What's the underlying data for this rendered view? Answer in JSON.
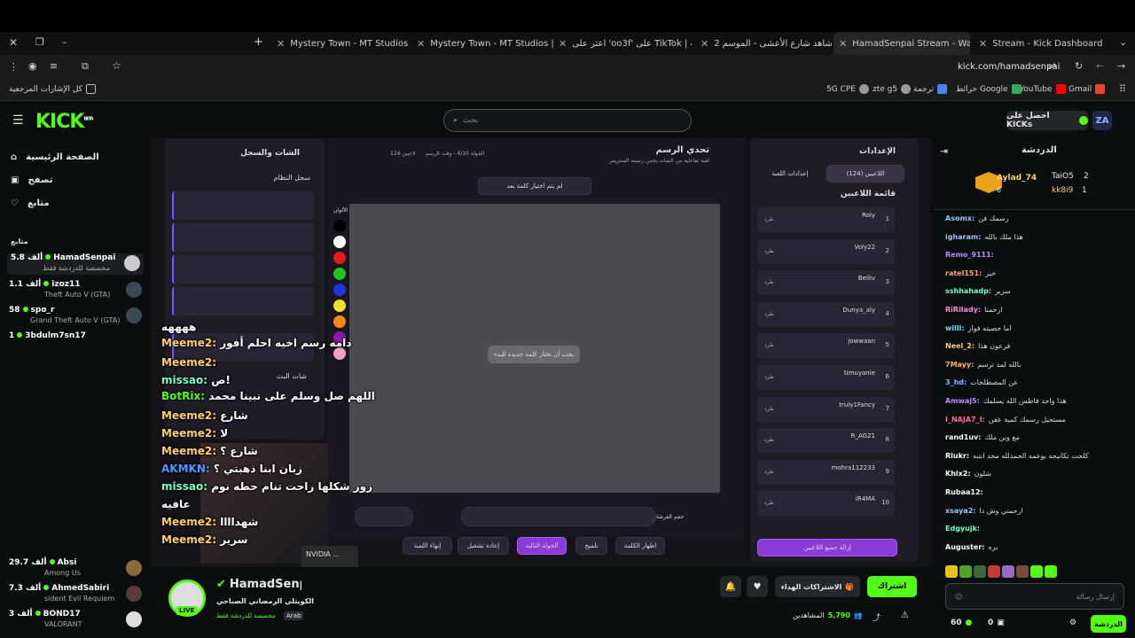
{
  "browser": {
    "tabs": [
      {
        "label": "Mystery Town - MT Studios | M"
      },
      {
        "label": "Mystery Town - MT Studios | M"
      },
      {
        "label": "اعثر على 'oo3f' على TikTok | بحث"
      },
      {
        "label": "شاهد شارع الأعشى - الموسم 2 /"
      },
      {
        "label": "HamadSenpai Stream - Watch"
      },
      {
        "label": "Stream - Kick Dashboard"
      }
    ],
    "url": "kick.com/hamadsenpai",
    "bookmarks": [
      {
        "label": "Gmail"
      },
      {
        "label": "YouTube"
      },
      {
        "label": "خرائط Google"
      },
      {
        "label": "ترجمة"
      },
      {
        "label": "zte g5"
      },
      {
        "label": "5G CPE"
      }
    ],
    "all_bookmarks": "كل الإشارات المرجعية"
  },
  "header": {
    "logo": "KICK",
    "logo_badge": "BETA",
    "search_placeholder": "بحث",
    "get_kicks": "احصل على KICKs",
    "avatar": "ZA"
  },
  "sidebar": {
    "nav": [
      {
        "label": "الصفحة الرئيسية",
        "icon": "home-icon"
      },
      {
        "label": "تصفح",
        "icon": "browse-icon"
      },
      {
        "label": "متابع",
        "icon": "heart-icon"
      }
    ],
    "following_title": "متابع",
    "channels": [
      {
        "name": "HamadSenpai",
        "viewers": "5.8 ألف",
        "game": "مخصصة للدردشة فقط"
      },
      {
        "name": "izoz11",
        "viewers": "1.1 ألف",
        "game": "Theft Auto V (GTA)"
      },
      {
        "name": "spo_r",
        "viewers": "58",
        "game": "Grand Theft Auto V (GTA)"
      },
      {
        "name": "3bdulm7sn17",
        "viewers": "1",
        "game": ""
      },
      {
        "name": "Absi",
        "viewers": "29.7 ألف",
        "game": "Among Us"
      },
      {
        "name": "AhmedSabiri",
        "viewers": "7.3 ألف",
        "game": "sident Evil Requiem"
      },
      {
        "name": "BOND17",
        "viewers": "3 ألف",
        "game": "VALORANT"
      }
    ]
  },
  "stream_overlay": {
    "messages": [
      {
        "user": "",
        "text": "ههههه"
      },
      {
        "user": "Meeme2:",
        "text": "دامه رسم اخيه احلم أفور"
      },
      {
        "user": "Meeme2:",
        "text": ""
      },
      {
        "user": "missao:",
        "text": "ص!"
      },
      {
        "user": "BotRix:",
        "text": "اللهم صل وسلم على نبينا محمد"
      },
      {
        "user": "Meeme2:",
        "text": "شارع"
      },
      {
        "user": "Meeme2:",
        "text": "لا"
      },
      {
        "user": "Meeme2:",
        "text": "شارع ؟"
      },
      {
        "user": "AKMKN:",
        "text": "زبان ابنا ذهبتي ؟"
      },
      {
        "user": "missao:",
        "text": "زور شكلها راحت تنام حطه نوم"
      },
      {
        "user": "",
        "text": "عافيه"
      },
      {
        "user": "Meeme2:",
        "text": "شهداااا"
      },
      {
        "user": "Meeme2:",
        "text": "سرير"
      }
    ],
    "game": {
      "title": "تحدي الرسم",
      "subtitle": "لعبة تفاعلية من الشات يخمن رسمة الستريمر",
      "round_info": "الجولة 4/10 - وقت الرسم",
      "players_count": "124 لاعبين",
      "no_word": "لم يتم اختيار كلمة بعد",
      "select_prompt": "يجب أن تختار كلمة جديدة للبدء",
      "settings_title": "الإعدادات",
      "tab_players": "اللاعبين (124)",
      "tab_game_settings": "إعدادات اللعبة",
      "players_list_title": "قائمة اللاعبين",
      "chat_log_title": "الشات والسجل",
      "system_log": "سجل النظام",
      "live_chat": "شات البث",
      "colors_label": "الألوان",
      "brush_size": "حجم الفرشاة",
      "players": [
        {
          "rank": "1",
          "name": "Roly"
        },
        {
          "rank": "2",
          "name": "Voly22"
        },
        {
          "rank": "3",
          "name": "Beiliv"
        },
        {
          "rank": "4",
          "name": "Dunya_aly"
        },
        {
          "rank": "5",
          "name": "jowwaan"
        },
        {
          "rank": "6",
          "name": "timuyanie"
        },
        {
          "rank": "7",
          "name": "truly1Fancy"
        },
        {
          "rank": "8",
          "name": "R_AG21"
        },
        {
          "rank": "9",
          "name": "mohra112233"
        },
        {
          "rank": "10",
          "name": "iR4MA"
        }
      ],
      "kick_label": "طرد",
      "remove_all": "إزالة جميع اللاعبين",
      "buttons": [
        "إنهاء اللعبة",
        "إعادة تشغيل",
        "الجولة التالية",
        "تلميح",
        "اظهار الكلمة"
      ]
    }
  },
  "nvidia": "NVIDIA ...",
  "channel_info": {
    "name": "HamadSenpai",
    "live": "LIVE",
    "title": "الكويتلي الرمضاني الصباحي",
    "category": "مخصصة للدردشة فقط",
    "language": "Arab",
    "viewers_label": "المشاهدين",
    "viewers": "5,790",
    "subscribe": "اشتراك",
    "gift_subs": "الاشتراكات الهداء"
  },
  "chat": {
    "title": "الدردشة",
    "leaderboard": [
      {
        "name": "Aylad_74",
        "count": "6"
      },
      {
        "name": "TaiO5",
        "count": "2"
      },
      {
        "name": "kk8i9",
        "count": "1"
      }
    ],
    "messages": [
      {
        "user": "Asomx:",
        "text": "رسمك فن",
        "color": "#9ec3ff"
      },
      {
        "user": "igharam:",
        "text": "هذا ملك بالله",
        "color": "#9ec3ff"
      },
      {
        "user": "Remo_9111:",
        "text": "",
        "color": "#b48cff"
      },
      {
        "user": "ratel151:",
        "text": "خير",
        "color": "#ff9f7a"
      },
      {
        "user": "sshhahadp:",
        "text": "سرير",
        "color": "#7affc7"
      },
      {
        "user": "RiRilady:",
        "text": "ارحمنا",
        "color": "#ff8ad8"
      },
      {
        "user": "willl:",
        "text": "اما حصيته فواز",
        "color": "#7ad9ff"
      },
      {
        "user": "Neel_2:",
        "text": "فرعون هذا",
        "color": "#ffcf6a"
      },
      {
        "user": "7Mayy:",
        "text": "بالله لمد ترسم",
        "color": "#ffb36a"
      },
      {
        "user": "3_hd:",
        "text": "عن المصطلحات",
        "color": "#8ab4ff"
      },
      {
        "user": "Amwaj5:",
        "text": "هذا واحد فاطس الله يسلمك",
        "color": "#c58aff"
      },
      {
        "user": "I_NAJA7_I:",
        "text": "مستحيل رسمك كمية عفن",
        "color": "#ff6a9a"
      },
      {
        "user": "rand1uv:",
        "text": "مع وين ملك",
        "color": "#ffffff"
      },
      {
        "user": "Rlukr:",
        "text": "كلحت تكانيجه بوعمه الحمدلله محد انتبه",
        "color": "#ffffff"
      },
      {
        "user": "Khix2:",
        "text": "شلون",
        "color": "#ffffff"
      },
      {
        "user": "Rubaa12:",
        "text": "",
        "color": "#ffffff"
      },
      {
        "user": "xsaya2:",
        "text": "ارحمني وش دا",
        "color": "#9ec3ff"
      },
      {
        "user": "Edgyujk:",
        "text": "",
        "color": "#7affc7"
      },
      {
        "user": "Auguster:",
        "text": "بره",
        "color": "#ffffff"
      }
    ],
    "input_placeholder": "إرسال رسالة",
    "send": "الدردشة",
    "kicks_count": "0",
    "points": "60"
  },
  "colors": {
    "kick_green": "#53fc18",
    "purple": "#a43ef0"
  }
}
